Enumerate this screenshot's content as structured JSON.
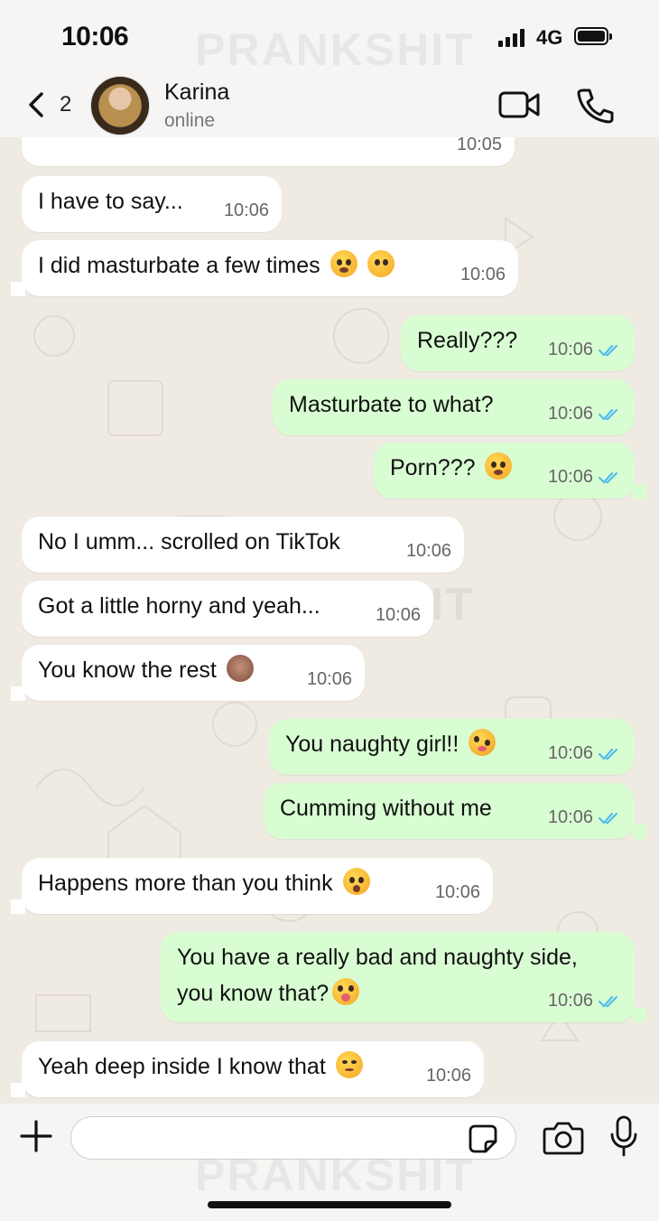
{
  "status_bar": {
    "time": "10:06",
    "network": "4G"
  },
  "watermark": "PRANKSHIT",
  "header": {
    "back_count": "2",
    "contact_name": "Karina",
    "contact_status": "online"
  },
  "messages": [
    {
      "dir": "in",
      "text": "",
      "time": "10:05"
    },
    {
      "dir": "in",
      "text": "I have to say...",
      "time": "10:06"
    },
    {
      "dir": "in",
      "text": "I did masturbate a few times",
      "time": "10:06"
    },
    {
      "dir": "out",
      "text": "Really???",
      "time": "10:06"
    },
    {
      "dir": "out",
      "text": "Masturbate to what?",
      "time": "10:06"
    },
    {
      "dir": "out",
      "text": "Porn???",
      "time": "10:06"
    },
    {
      "dir": "in",
      "text": "No I umm... scrolled on TikTok",
      "time": "10:06"
    },
    {
      "dir": "in",
      "text": "Got a little horny and yeah...",
      "time": "10:06"
    },
    {
      "dir": "in",
      "text": "You know the rest",
      "time": "10:06"
    },
    {
      "dir": "out",
      "text": "You naughty girl!!",
      "time": "10:06"
    },
    {
      "dir": "out",
      "text": "Cumming without me",
      "time": "10:06"
    },
    {
      "dir": "in",
      "text": "Happens more than you think",
      "time": "10:06"
    },
    {
      "dir": "out",
      "text": "You have a really bad and naughty side,",
      "text2": "you know that?",
      "time": "10:06"
    },
    {
      "dir": "in",
      "text": "Yeah deep inside I know that",
      "time": "10:06"
    }
  ],
  "input": {
    "placeholder": "",
    "value": ""
  },
  "colors": {
    "outgoing": "#d9fdd3",
    "incoming": "#ffffff",
    "ticks": "#53bdeb",
    "chat_bg": "#efeae2"
  }
}
